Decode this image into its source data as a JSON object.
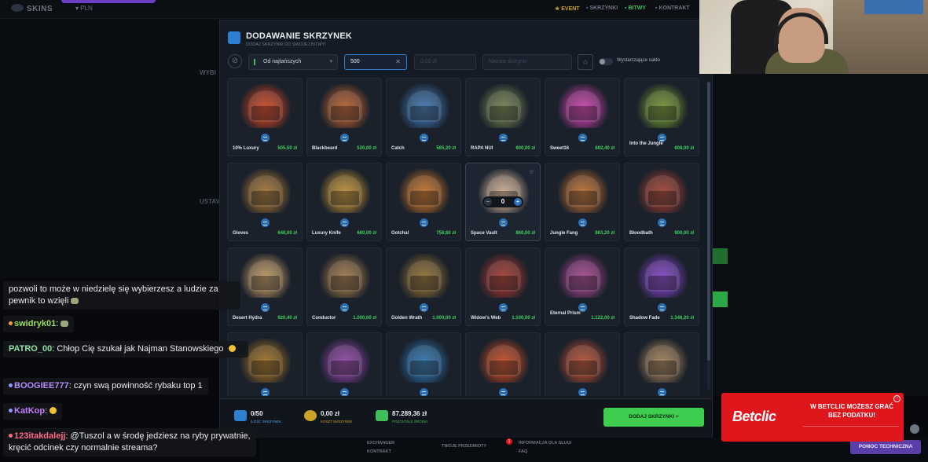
{
  "site": {
    "brand": "SKINS",
    "lang": "PLN",
    "nav": [
      {
        "label": "EVENT"
      },
      {
        "label": "SKRZYNKI"
      },
      {
        "label": "BITWY"
      },
      {
        "label": "KONTRAKT"
      }
    ],
    "bg_labels": [
      "WYBI",
      "USTAV"
    ]
  },
  "modal": {
    "title": "DODAWANIE SKRZYNEK",
    "subtitle": "DODAJ SKRZYNKI DO SWOJEJ BITWY!",
    "sort_label": "Od najtańszych",
    "search_min": "500",
    "search_max_placeholder": "0,00 zł",
    "search_name_placeholder": "Nazwa skrzynki",
    "toggle_label": "Wystarczające saldo"
  },
  "cases": [
    {
      "name": "10% Luxury",
      "price": "505,50 zł",
      "color": "#c8401f"
    },
    {
      "name": "Blackbeard",
      "price": "520,00 zł",
      "color": "#b15a2a"
    },
    {
      "name": "Catch",
      "price": "565,20 zł",
      "color": "#3a6fa8"
    },
    {
      "name": "RAPA NUI",
      "price": "600,00 zł",
      "color": "#6c7a4a"
    },
    {
      "name": "Sweet16",
      "price": "602,40 zł",
      "color": "#c53ca6"
    },
    {
      "name": "Into the Jungle",
      "price": "608,00 zł",
      "color": "#6b8f2c"
    },
    {
      "name": "Gloves",
      "price": "640,00 zł",
      "color": "#a0702e"
    },
    {
      "name": "Luxury Knife",
      "price": "660,00 zł",
      "color": "#b98a2f"
    },
    {
      "name": "Gotcha!",
      "price": "758,80 zł",
      "color": "#c06d24"
    },
    {
      "name": "Space Vault",
      "price": "860,00 zł",
      "color": "#c9a98d",
      "counter": "0"
    },
    {
      "name": "Jungle Fang",
      "price": "863,20 zł",
      "color": "#b5682b"
    },
    {
      "name": "Bloodbath",
      "price": "900,00 zł",
      "color": "#9c3b2c"
    },
    {
      "name": "Desert Hydra",
      "price": "920,40 zł",
      "color": "#b8915c"
    },
    {
      "name": "Conductor",
      "price": "1.000,00 zł",
      "color": "#9a7244"
    },
    {
      "name": "Golden Wrath",
      "price": "1.000,00 zł",
      "color": "#8c6a2e"
    },
    {
      "name": "Widow's Web",
      "price": "1.100,00 zł",
      "color": "#a0342c"
    },
    {
      "name": "Eternal Prism",
      "price": "1.122,00 zł",
      "color": "#a0418a"
    },
    {
      "name": "Shadow Fade",
      "price": "1.346,20 zł",
      "color": "#7d3fc0"
    },
    {
      "name": "",
      "price": "",
      "color": "#9a6a1f"
    },
    {
      "name": "",
      "price": "",
      "color": "#8b3fa0"
    },
    {
      "name": "",
      "price": "",
      "color": "#2a6fa8"
    },
    {
      "name": "",
      "price": "",
      "color": "#c0461f"
    },
    {
      "name": "",
      "price": "",
      "color": "#b1492d"
    },
    {
      "name": "",
      "price": "",
      "color": "#9c7a52"
    }
  ],
  "footer": {
    "count_value": "0/50",
    "count_label": "ILOŚĆ SKRZYNEK",
    "cost_value": "0,00 zł",
    "cost_label": "KOSZT SKRZYNEK",
    "left_value": "87.289,36 zł",
    "left_label": "POZOSTAŁE ŚRODKI",
    "add_button": "DODAJ SKRZYNKI +"
  },
  "chat": [
    {
      "user": "",
      "text": "pozwoli to może w niedzielę się wybierzesz a ludzie za pewnik to wzięli",
      "user_color": "#e9ecef"
    },
    {
      "user": "swidryk01",
      "text": ":",
      "user_color": "#9be05c"
    },
    {
      "user": "PATRO_00",
      "text": ": Chłop Cię szukał jak Najman Stanowskiego",
      "user_color": "#8fe0a6"
    },
    {
      "user": "BOOGIEE777",
      "text": ": czyn swą powinność rybaku top 1",
      "user_color": "#b58cff"
    },
    {
      "user": "KatKop",
      "text": ":",
      "user_color": "#c57dff"
    },
    {
      "user": "123itakdalejj",
      "text": ": @Tuszol a w środę jedziesz na ryby prywatnie, kręcić odcinek czy normalnie streama?",
      "user_color": "#ff6a88"
    }
  ],
  "ad": {
    "logo": "Betclic",
    "text_line1": "W BETCLIC MOŻESZ GRAĆ",
    "text_line2": "BEZ PODATKU!"
  },
  "bottom": {
    "links": [
      "EXCHANGER",
      "KONTRAKT",
      "TWOJE PRZEDMIOTY",
      "INFORMACJA DLA SŁUGI",
      "FAQ"
    ],
    "notif": "1",
    "help": "POMOC TECHNICZNA"
  }
}
